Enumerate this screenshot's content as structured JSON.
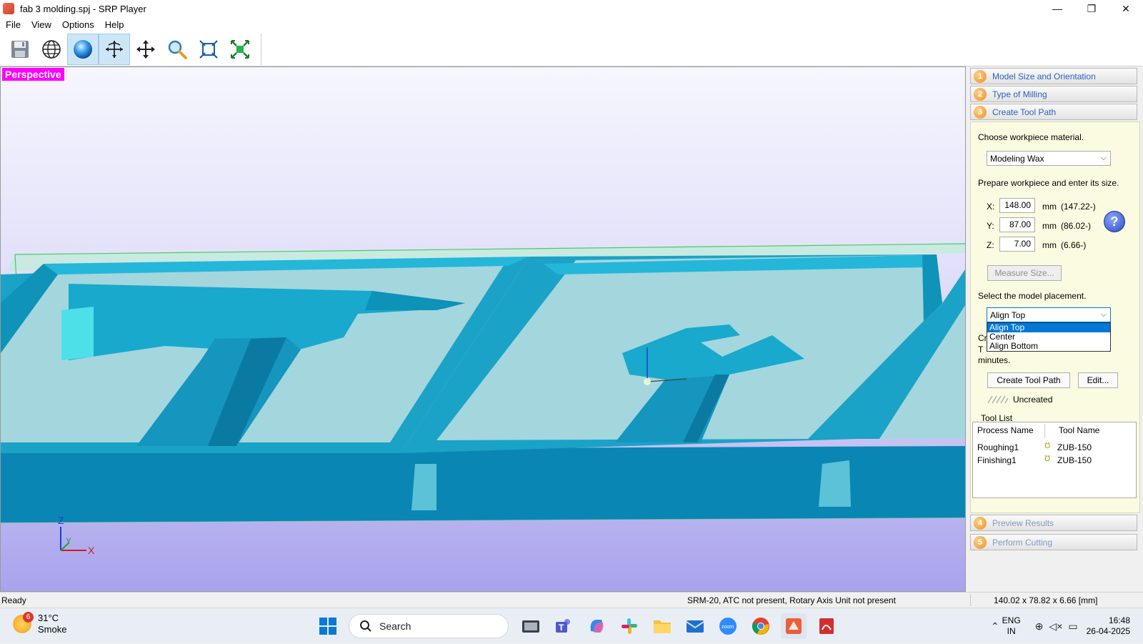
{
  "window": {
    "title": "fab 3 molding.spj - SRP Player",
    "minimize": "—",
    "maximize": "❐",
    "close": "✕"
  },
  "menu": [
    "File",
    "View",
    "Options",
    "Help"
  ],
  "toolbar": {
    "buttons": [
      "save-icon",
      "globe-icon",
      "shaded-sphere-icon",
      "rotate-icon",
      "pan-icon",
      "zoom-icon",
      "fit-icon",
      "zoom-extents-icon"
    ],
    "active": [
      "shaded-sphere-icon",
      "rotate-icon"
    ]
  },
  "viewport": {
    "mode_label": "Perspective",
    "axis_z": "Z",
    "axis_y": "Y",
    "axis_x": "X",
    "colors": {
      "label_bg": "#ff00ff",
      "model": "#10a6c8",
      "bounding_box": "#44cc66"
    }
  },
  "panel": {
    "steps": [
      {
        "num": "1",
        "label": "Model Size and Orientation"
      },
      {
        "num": "2",
        "label": "Type of Milling"
      },
      {
        "num": "3",
        "label": "Create Tool Path"
      },
      {
        "num": "4",
        "label": "Preview Results"
      },
      {
        "num": "5",
        "label": "Perform Cutting"
      }
    ],
    "material_prompt": "Choose workpiece material.",
    "material_value": "Modeling Wax",
    "size_prompt": "Prepare workpiece and enter its size.",
    "size": {
      "x_label": "X:",
      "x_value": "148.00",
      "x_unit": "mm",
      "x_model": "(147.22-)",
      "y_label": "Y:",
      "y_value": "87.00",
      "y_unit": "mm",
      "y_model": "(86.02-)",
      "z_label": "Z:",
      "z_value": "7.00",
      "z_unit": "mm",
      "z_model": "(6.66-)"
    },
    "help_label": "?",
    "measure_button": "Measure Size...",
    "placement_prompt": "Select the model placement.",
    "placement_value": "Align Top",
    "placement_options": [
      "Align Top",
      "Center",
      "Align Bottom"
    ],
    "hidden_text_1": "Cr",
    "hidden_text_2": "T",
    "hidden_text_3": "minutes.",
    "create_button": "Create Tool Path",
    "edit_button": "Edit...",
    "status": "Uncreated",
    "toollist_title": "Tool List",
    "toollist_headers": [
      "Process Name",
      "Tool Name"
    ],
    "toollist_rows": [
      {
        "process": "Roughing1",
        "tool": "ZUB-150"
      },
      {
        "process": "Finishing1",
        "tool": "ZUB-150"
      }
    ]
  },
  "statusbar": {
    "left": "Ready",
    "machine": "SRM-20, ATC not present, Rotary Axis Unit not present",
    "dims": "140.02 x  78.82 x   6.66 [mm]"
  },
  "taskbar": {
    "weather_badge": "6",
    "temperature": "31°C",
    "condition": "Smoke",
    "search_label": "Search",
    "lang_1": "ENG",
    "lang_2": "IN",
    "time": "16:48",
    "date": "26-04-2025"
  }
}
